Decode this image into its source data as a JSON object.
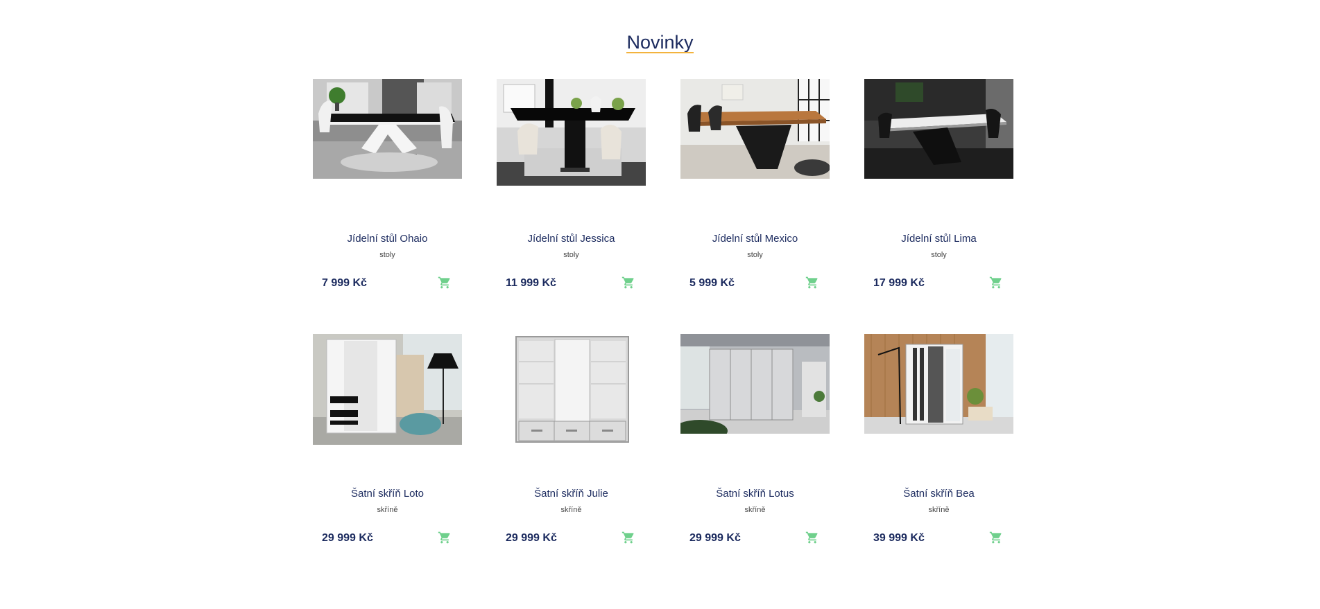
{
  "section": {
    "title": "Novinky"
  },
  "colors": {
    "title": "#1b2a5e",
    "underline": "#f3b33d",
    "price": "#1b2a5e",
    "cart": "#6fd08c"
  },
  "products": [
    {
      "name": "Jídelní stůl Ohaio",
      "category": "stoly",
      "price": "7 999 Kč",
      "image": "dining-table-white-v-base-photo",
      "cart_icon": "cart-icon"
    },
    {
      "name": "Jídelní stůl Jessica",
      "category": "stoly",
      "price": "11 999 Kč",
      "image": "dining-table-black-gloss-photo",
      "cart_icon": "cart-icon"
    },
    {
      "name": "Jídelní stůl Mexico",
      "category": "stoly",
      "price": "5 999 Kč",
      "image": "dining-table-oak-photo",
      "cart_icon": "cart-icon"
    },
    {
      "name": "Jídelní stůl Lima",
      "category": "stoly",
      "price": "17 999 Kč",
      "image": "dining-table-marble-photo",
      "cart_icon": "cart-icon"
    },
    {
      "name": "Šatní skříň Loto",
      "category": "skříně",
      "price": "29 999 Kč",
      "image": "wardrobe-white-black-photo",
      "cart_icon": "cart-icon"
    },
    {
      "name": "Šatní skříň Julie",
      "category": "skříně",
      "price": "29 999 Kč",
      "image": "wardrobe-mirror-photo",
      "cart_icon": "cart-icon"
    },
    {
      "name": "Šatní skříň Lotus",
      "category": "skříně",
      "price": "29 999 Kč",
      "image": "wardrobe-grey-sliding-photo",
      "cart_icon": "cart-icon"
    },
    {
      "name": "Šatní skříň Bea",
      "category": "skříně",
      "price": "39 999 Kč",
      "image": "wardrobe-white-graphite-photo",
      "cart_icon": "cart-icon"
    }
  ]
}
